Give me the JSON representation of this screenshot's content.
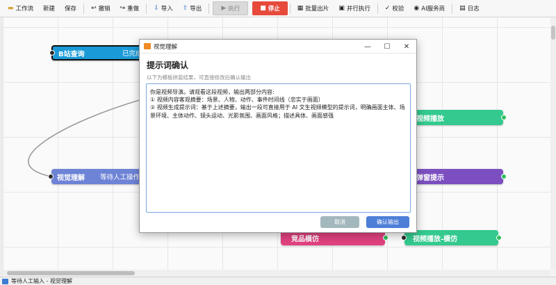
{
  "toolbar": {
    "workflow": "工作流",
    "new": "新建",
    "save": "保存",
    "undo": "撤销",
    "redo": "重做",
    "import": "导入",
    "export": "导出",
    "execute": "执行",
    "stop": "停止",
    "batch": "批量出片",
    "parallel": "并行执行",
    "verify": "校验",
    "ai_store": "AI服务商",
    "log": "日志"
  },
  "nodes": [
    {
      "title": "B站查询",
      "status": "已完成",
      "color": "#1a9ad6"
    },
    {
      "title": "视觉理解",
      "status": "等待人工操作",
      "color": "#6d83d6"
    },
    {
      "title": "视频播放",
      "status": "",
      "color": "#34c98e"
    },
    {
      "title": "弹窗提示",
      "status": "",
      "color": "#7b4fc0"
    },
    {
      "title": "竞品模仿",
      "status": "",
      "color": "#e0417f"
    },
    {
      "title": "视频播放-模仿",
      "status": "",
      "color": "#34c98e"
    }
  ],
  "dialog": {
    "window_title": "视觉理解",
    "heading": "提示词确认",
    "subtitle": "以下为模板拼装结果，可直接修改后确认输出",
    "prompt_text": "你是视频导演。请观看这段视频，输出两部分内容:\n① 视频内容客观摘要：场景、人物、动作、事件时间线（忠实于画面）\n② 视频生成提示词：基于上述摘要，输出一段可直接用于 AI 文生视频模型的提示词，明确画面主体、场景环境、主体动作、镜头运动、光影氛围、画面风格；描述具体、画面感强",
    "cancel": "取消",
    "confirm": "确认输出"
  },
  "statusbar": {
    "text": "等待人工输入 - 视觉理解"
  },
  "colors": {
    "accent": "#4d7fd8",
    "stop": "#e74a3b"
  }
}
